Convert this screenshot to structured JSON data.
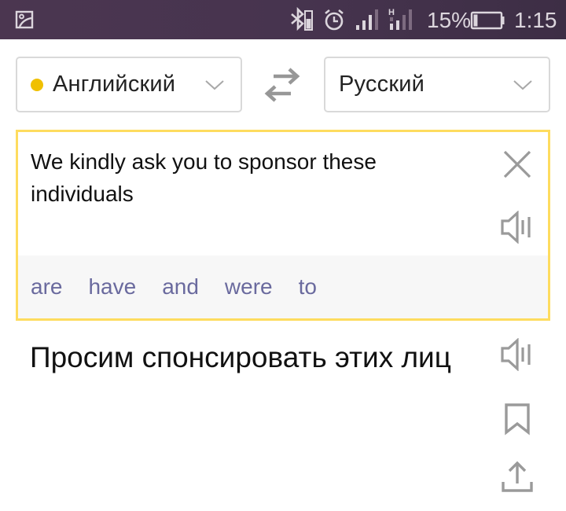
{
  "status_bar": {
    "left_icon": "gallery-icon",
    "icons": [
      "bluetooth-icon",
      "alarm-icon",
      "signal-icon",
      "signal-h-icon",
      "battery-icon"
    ],
    "battery_percent": "15%",
    "battery_level": 0.15,
    "time": "1:15"
  },
  "languages": {
    "source": {
      "label": "Английский",
      "dot_color": "#f0c000",
      "icon": "chevron-down-icon"
    },
    "swap_icon": "swap-icon",
    "target": {
      "label": "Русский",
      "icon": "chevron-down-icon"
    }
  },
  "input": {
    "text": "We kindly ask you to sponsor these individuals",
    "border_color": "#fedc5f",
    "clear_icon": "close-icon",
    "speak_icon": "speaker-icon",
    "suggestions": [
      "are",
      "have",
      "and",
      "were",
      "to"
    ]
  },
  "translation": {
    "text": "Просим спонсировать этих лиц",
    "actions": [
      "speaker-icon",
      "bookmark-icon",
      "share-icon"
    ]
  }
}
